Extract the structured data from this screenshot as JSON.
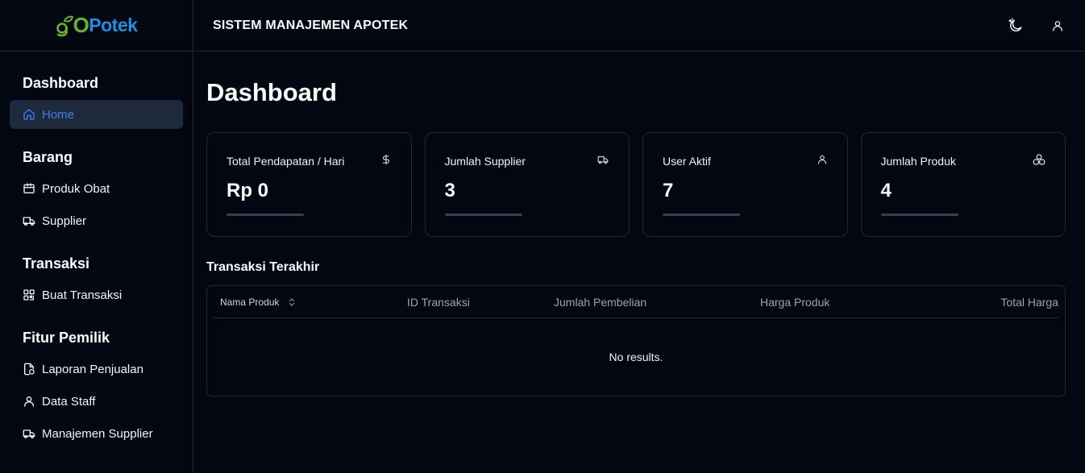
{
  "brand": {
    "logo_go": "go",
    "logo_potek": "Potek",
    "colors": {
      "go": "#65b32e",
      "potek": "#1f8fe0"
    }
  },
  "header": {
    "title": "SISTEM MANAJEMEN APOTEK",
    "icons": [
      "theme-toggle-icon",
      "user-icon"
    ]
  },
  "sidebar": {
    "sections": [
      {
        "title": "Dashboard",
        "items": [
          {
            "label": "Home",
            "icon": "home-icon",
            "active": true
          }
        ]
      },
      {
        "title": "Barang",
        "items": [
          {
            "label": "Produk Obat",
            "icon": "package-icon"
          },
          {
            "label": "Supplier",
            "icon": "truck-icon"
          }
        ]
      },
      {
        "title": "Transaksi",
        "items": [
          {
            "label": "Buat Transaksi",
            "icon": "scan-icon"
          }
        ]
      },
      {
        "title": "Fitur Pemilik",
        "items": [
          {
            "label": "Laporan Penjualan",
            "icon": "report-icon"
          },
          {
            "label": "Data Staff",
            "icon": "user-icon"
          },
          {
            "label": "Manajemen Supplier",
            "icon": "truck-icon"
          }
        ]
      }
    ]
  },
  "main": {
    "title": "Dashboard",
    "cards": [
      {
        "label": "Total Pendapatan / Hari",
        "value": "Rp 0",
        "icon": "dollar-icon"
      },
      {
        "label": "Jumlah Supplier",
        "value": "3",
        "icon": "truck-icon"
      },
      {
        "label": "User Aktif",
        "value": "7",
        "icon": "user-icon"
      },
      {
        "label": "Jumlah Produk",
        "value": "4",
        "icon": "boxes-icon"
      }
    ],
    "recent": {
      "title": "Transaksi Terakhir",
      "columns": [
        "Nama Produk",
        "ID Transaksi",
        "Jumlah Pembelian",
        "Harga Produk",
        "Total Harga"
      ],
      "empty_text": "No results."
    }
  },
  "accent": "#3b82f6"
}
